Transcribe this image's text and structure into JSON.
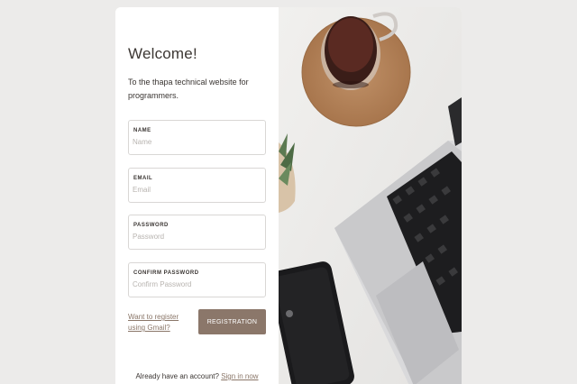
{
  "form": {
    "title": "Welcome!",
    "subtitle": "To the thapa technical website for programmers.",
    "fields": [
      {
        "label": "NAME",
        "placeholder": "Name",
        "value": ""
      },
      {
        "label": "EMAIL",
        "placeholder": "Email",
        "value": ""
      },
      {
        "label": "PASSWORD",
        "placeholder": "Password",
        "value": ""
      },
      {
        "label": "CONFIRM PASSWORD",
        "placeholder": "Confirm Password",
        "value": ""
      }
    ],
    "gmail_link": "Want to register using Gmail?",
    "register_button": "REGISTRATION",
    "signin_prompt": "Already have an account?",
    "signin_link": "Sign in now"
  },
  "colors": {
    "accent": "#8b776a",
    "link": "#8a7668",
    "page_background": "#ecebea"
  },
  "image": {
    "description_icons": [
      "coffee-cup",
      "cork-coaster",
      "laptop",
      "smartphone",
      "succulent-plant"
    ]
  }
}
